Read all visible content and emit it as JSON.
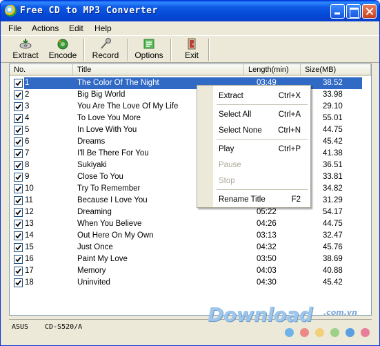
{
  "window": {
    "title": "Free CD to MP3 Converter"
  },
  "menu": {
    "file": "File",
    "actions": "Actions",
    "edit": "Edit",
    "help": "Help"
  },
  "toolbar": {
    "extract": "Extract",
    "encode": "Encode",
    "record": "Record",
    "options": "Options",
    "exit": "Exit"
  },
  "list": {
    "columns": {
      "no": "No.",
      "title": "Title",
      "length": "Length(min)",
      "size": "Size(MB)"
    },
    "selected_index": 0,
    "tracks": [
      {
        "no": "1",
        "title": "The Color Of The Night",
        "length": "03:49",
        "size": "38.52",
        "checked": true
      },
      {
        "no": "2",
        "title": "Big Big World",
        "length": "",
        "size": "33.98",
        "checked": true
      },
      {
        "no": "3",
        "title": "You Are The Love Of My Life",
        "length": "",
        "size": "29.10",
        "checked": true
      },
      {
        "no": "4",
        "title": "To Love You More",
        "length": "",
        "size": "55.01",
        "checked": true
      },
      {
        "no": "5",
        "title": "In Love With You",
        "length": "",
        "size": "44.75",
        "checked": true
      },
      {
        "no": "6",
        "title": "Dreams",
        "length": "",
        "size": "45.42",
        "checked": true
      },
      {
        "no": "7",
        "title": "I'll Be There For You",
        "length": "",
        "size": "41.38",
        "checked": true
      },
      {
        "no": "8",
        "title": "Sukiyaki",
        "length": "",
        "size": "36.51",
        "checked": true
      },
      {
        "no": "9",
        "title": "Close To You",
        "length": "",
        "size": "33.81",
        "checked": true
      },
      {
        "no": "10",
        "title": "Try To Remember",
        "length": "",
        "size": "34.82",
        "checked": true
      },
      {
        "no": "11",
        "title": "Because I Love You",
        "length": "",
        "size": "31.29",
        "checked": true
      },
      {
        "no": "12",
        "title": "Dreaming",
        "length": "05:22",
        "size": "54.17",
        "checked": true
      },
      {
        "no": "13",
        "title": "When You Believe",
        "length": "04:26",
        "size": "44.75",
        "checked": true
      },
      {
        "no": "14",
        "title": "Out Here On My Own",
        "length": "03:13",
        "size": "32.47",
        "checked": true
      },
      {
        "no": "15",
        "title": "Just Once",
        "length": "04:32",
        "size": "45.76",
        "checked": true
      },
      {
        "no": "16",
        "title": "Paint My Love",
        "length": "03:50",
        "size": "38.69",
        "checked": true
      },
      {
        "no": "17",
        "title": "Memory",
        "length": "04:03",
        "size": "40.88",
        "checked": true
      },
      {
        "no": "18",
        "title": "Uninvited",
        "length": "04:30",
        "size": "45.42",
        "checked": true
      }
    ]
  },
  "context_menu": {
    "items": [
      {
        "label": "Extract",
        "shortcut": "Ctrl+X",
        "enabled": true
      },
      {
        "label": "Select All",
        "shortcut": "Ctrl+A",
        "enabled": true
      },
      {
        "label": "Select None",
        "shortcut": "Ctrl+N",
        "enabled": true
      },
      {
        "label": "Play",
        "shortcut": "Ctrl+P",
        "enabled": true
      },
      {
        "label": "Pause",
        "shortcut": "",
        "enabled": false
      },
      {
        "label": "Stop",
        "shortcut": "",
        "enabled": false
      },
      {
        "label": "Rename Title",
        "shortcut": "F2",
        "enabled": true
      }
    ]
  },
  "status": {
    "drive": "ASUS",
    "model": "CD-S520/A"
  },
  "watermark": {
    "brand": "Download",
    "suffix": ".com.vn",
    "dot_colors": [
      "#6fb4e8",
      "#e98a87",
      "#f2d07a",
      "#9fd08a",
      "#5aa0e0",
      "#e87f9a"
    ]
  },
  "colors": {
    "selection": "#316ac5",
    "titlebar": "#0448d6",
    "window_bg": "#ece9d8"
  }
}
